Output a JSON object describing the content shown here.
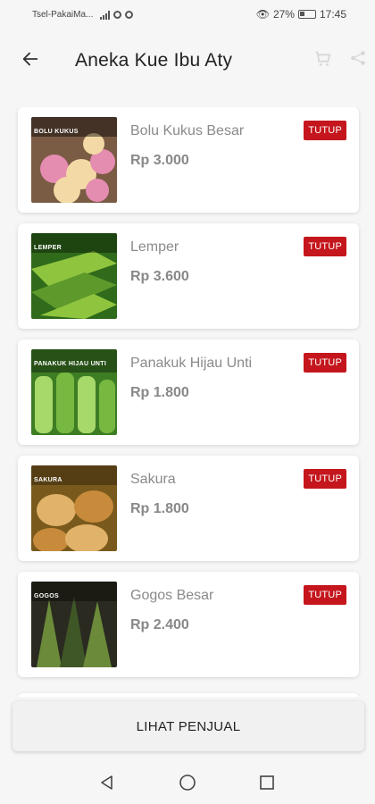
{
  "status_bar": {
    "carrier": "Tsel-PakaiMa...",
    "battery": "27%",
    "time": "17:45"
  },
  "app_bar": {
    "title": "Aneka Kue Ibu Aty"
  },
  "items": [
    {
      "name": "Bolu Kukus Besar",
      "price": "Rp 3.000",
      "status": "TUTUP",
      "thumb_label": "BOLU KUKUS",
      "thumb_colors": [
        "#7a5b44",
        "#e58cb1",
        "#f3d9a5"
      ]
    },
    {
      "name": "Lemper",
      "price": "Rp 3.600",
      "status": "TUTUP",
      "thumb_label": "LEMPER",
      "thumb_colors": [
        "#2f6b1a",
        "#8fc43f",
        "#5e9a2b"
      ]
    },
    {
      "name": "Panakuk Hijau Unti",
      "price": "Rp 1.800",
      "status": "TUTUP",
      "thumb_label": "PANAKUK HIJAU UNTI",
      "thumb_colors": [
        "#3d7d23",
        "#a7d86a",
        "#77b840"
      ]
    },
    {
      "name": "Sakura",
      "price": "Rp 1.800",
      "status": "TUTUP",
      "thumb_label": "SAKURA",
      "thumb_colors": [
        "#7a5a1c",
        "#e0b26a",
        "#c88b3c"
      ]
    },
    {
      "name": "Gogos Besar",
      "price": "Rp 2.400",
      "status": "TUTUP",
      "thumb_label": "GOGOS",
      "thumb_colors": [
        "#2a2a20",
        "#6b8a3a",
        "#3f5626"
      ]
    }
  ],
  "seller_button": {
    "label": "LIHAT PENJUAL"
  },
  "colors": {
    "badge": "#c4161c",
    "background": "#f6f6f6"
  }
}
